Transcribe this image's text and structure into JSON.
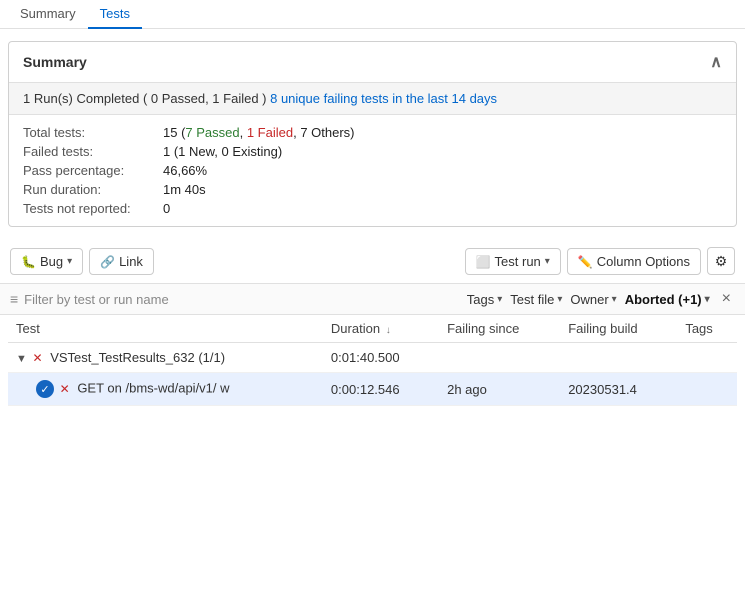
{
  "tabs": [
    {
      "id": "summary",
      "label": "Summary",
      "active": false
    },
    {
      "id": "tests",
      "label": "Tests",
      "active": true
    }
  ],
  "summary": {
    "title": "Summary",
    "banner": {
      "text": "1 Run(s) Completed ( 0 Passed, 1 Failed ) ",
      "link_text": "8 unique failing tests in the last 14 days",
      "link_href": "#"
    },
    "stats": [
      {
        "label": "Total tests:",
        "value": "15 (7 Passed, 1 Failed, 7 Others)",
        "has_colors": true
      },
      {
        "label": "Failed tests:",
        "value": "1 (1 New, 0 Existing)",
        "has_colors": false
      },
      {
        "label": "Pass percentage:",
        "value": "46,66%",
        "has_colors": false
      },
      {
        "label": "Run duration:",
        "value": "1m 40s",
        "has_colors": false
      },
      {
        "label": "Tests not reported:",
        "value": "0",
        "has_colors": false
      }
    ]
  },
  "toolbar": {
    "bug_label": "Bug",
    "link_label": "Link",
    "test_run_label": "Test run",
    "column_options_label": "Column Options"
  },
  "filter_bar": {
    "placeholder": "Filter by test or run name",
    "tags_label": "Tags",
    "test_file_label": "Test file",
    "owner_label": "Owner",
    "aborted_label": "Aborted (+1)"
  },
  "table": {
    "columns": [
      {
        "id": "test",
        "label": "Test"
      },
      {
        "id": "duration",
        "label": "Duration"
      },
      {
        "id": "failing_since",
        "label": "Failing since"
      },
      {
        "id": "failing_build",
        "label": "Failing build"
      },
      {
        "id": "tags",
        "label": "Tags"
      }
    ],
    "rows": [
      {
        "id": "row-group-1",
        "type": "group",
        "expand": true,
        "status": "failed",
        "test_name": "VSTest_TestResults_632 (1/1)",
        "duration": "0:01:40.500",
        "failing_since": "",
        "failing_build": "",
        "tags": "",
        "selected": false
      },
      {
        "id": "row-child-1",
        "type": "child",
        "status": "failed",
        "test_name": "GET on /bms-wd/api/v1/ w",
        "duration": "0:00:12.546",
        "failing_since": "2h ago",
        "failing_build": "20230531.4",
        "tags": "",
        "selected": true
      }
    ]
  }
}
